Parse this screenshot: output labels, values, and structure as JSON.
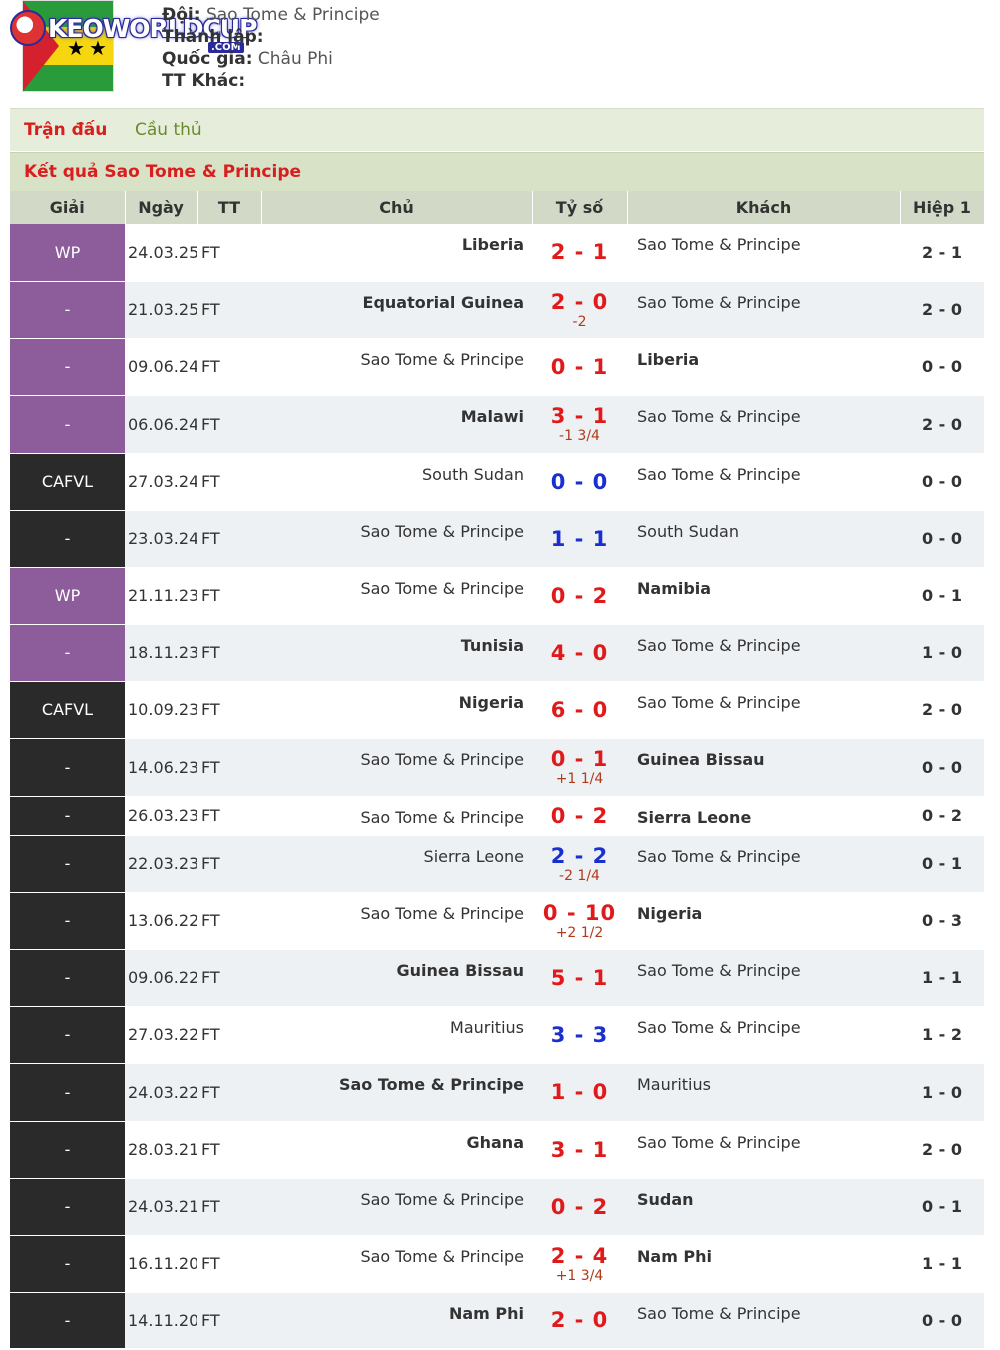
{
  "header": {
    "logo_text": "KEOWORLDCUP",
    "logo_sub": ".COM",
    "team_label": "Đội:",
    "team_value": "Sao Tome & Principe",
    "founded_label": "Thành lập:",
    "country_label": "Quốc gia:",
    "country_value": "Châu Phi",
    "other_label": "TT Khác:"
  },
  "tabs": {
    "matches": "Trận đấu",
    "players": "Cầu thủ"
  },
  "section_title": "Kết quả Sao Tome & Principe",
  "columns": [
    "Giải",
    "Ngày",
    "TT",
    "Chủ",
    "Tỷ số",
    "Khách",
    "Hiệp 1"
  ],
  "rows": [
    {
      "league": "WP",
      "lg": "purple",
      "date": "24.03.25",
      "status": "FT",
      "home": "Liberia",
      "home_bold": true,
      "score": "2 - 1",
      "score_color": "red",
      "hcap": "",
      "away": "Sao Tome & Principe",
      "away_bold": false,
      "ht": "2 - 1",
      "h": 57
    },
    {
      "league": "-",
      "lg": "purple",
      "date": "21.03.25",
      "status": "FT",
      "home": "Equatorial Guinea",
      "home_bold": true,
      "score": "2 - 0",
      "score_color": "red",
      "hcap": "-2",
      "away": "Sao Tome & Principe",
      "away_bold": false,
      "ht": "2 - 0",
      "h": 57
    },
    {
      "league": "-",
      "lg": "purple",
      "date": "09.06.24",
      "status": "FT",
      "home": "Sao Tome & Principe",
      "home_bold": false,
      "score": "0 - 1",
      "score_color": "red",
      "hcap": "",
      "away": "Liberia",
      "away_bold": true,
      "ht": "0 - 0",
      "h": 57
    },
    {
      "league": "-",
      "lg": "purple",
      "date": "06.06.24",
      "status": "FT",
      "home": "Malawi",
      "home_bold": true,
      "score": "3 - 1",
      "score_color": "red",
      "hcap": "-1 3/4",
      "away": "Sao Tome & Principe",
      "away_bold": false,
      "ht": "2 - 0",
      "h": 58
    },
    {
      "league": "CAFVL",
      "lg": "dark",
      "date": "27.03.24",
      "status": "FT",
      "home": "South Sudan",
      "home_bold": false,
      "score": "0 - 0",
      "score_color": "blue",
      "hcap": "",
      "away": "Sao Tome & Principe",
      "away_bold": false,
      "ht": "0 - 0",
      "h": 57
    },
    {
      "league": "-",
      "lg": "dark",
      "date": "23.03.24",
      "status": "FT",
      "home": "Sao Tome & Principe",
      "home_bold": false,
      "score": "1 - 1",
      "score_color": "blue",
      "hcap": "",
      "away": "South Sudan",
      "away_bold": false,
      "ht": "0 - 0",
      "h": 57
    },
    {
      "league": "WP",
      "lg": "purple",
      "date": "21.11.23",
      "status": "FT",
      "home": "Sao Tome & Principe",
      "home_bold": false,
      "score": "0 - 2",
      "score_color": "red",
      "hcap": "",
      "away": "Namibia",
      "away_bold": true,
      "ht": "0 - 1",
      "h": 57
    },
    {
      "league": "-",
      "lg": "purple",
      "date": "18.11.23",
      "status": "FT",
      "home": "Tunisia",
      "home_bold": true,
      "score": "4 - 0",
      "score_color": "red",
      "hcap": "",
      "away": "Sao Tome & Principe",
      "away_bold": false,
      "ht": "1 - 0",
      "h": 57
    },
    {
      "league": "CAFVL",
      "lg": "dark",
      "date": "10.09.23",
      "status": "FT",
      "home": "Nigeria",
      "home_bold": true,
      "score": "6 - 0",
      "score_color": "red",
      "hcap": "",
      "away": "Sao Tome & Principe",
      "away_bold": false,
      "ht": "2 - 0",
      "h": 57
    },
    {
      "league": "-",
      "lg": "dark",
      "date": "14.06.23",
      "status": "FT",
      "home": "Sao Tome & Principe",
      "home_bold": false,
      "score": "0 - 1",
      "score_color": "red",
      "hcap": "+1 1/4",
      "away": "Guinea Bissau",
      "away_bold": true,
      "ht": "0 - 0",
      "h": 58
    },
    {
      "league": "-",
      "lg": "dark",
      "date": "26.03.23",
      "status": "FT",
      "home": "Sao Tome & Principe",
      "home_bold": false,
      "score": "0 - 2",
      "score_color": "red",
      "hcap": "",
      "away": "Sierra Leone",
      "away_bold": true,
      "ht": "0 - 2",
      "h": 39
    },
    {
      "league": "-",
      "lg": "dark",
      "date": "22.03.23",
      "status": "FT",
      "home": "Sierra Leone",
      "home_bold": false,
      "score": "2 - 2",
      "score_color": "blue",
      "hcap": "-2 1/4",
      "away": "Sao Tome & Principe",
      "away_bold": false,
      "ht": "0 - 1",
      "h": 57
    },
    {
      "league": "-",
      "lg": "dark",
      "date": "13.06.22",
      "status": "FT",
      "home": "Sao Tome & Principe",
      "home_bold": false,
      "score": "0 - 10",
      "score_color": "red",
      "hcap": "+2 1/2",
      "away": "Nigeria",
      "away_bold": true,
      "ht": "0 - 3",
      "h": 57
    },
    {
      "league": "-",
      "lg": "dark",
      "date": "09.06.22",
      "status": "FT",
      "home": "Guinea Bissau",
      "home_bold": true,
      "score": "5 - 1",
      "score_color": "red",
      "hcap": "",
      "away": "Sao Tome & Principe",
      "away_bold": false,
      "ht": "1 - 1",
      "h": 57
    },
    {
      "league": "-",
      "lg": "dark",
      "date": "27.03.22",
      "status": "FT",
      "home": "Mauritius",
      "home_bold": false,
      "score": "3 - 3",
      "score_color": "blue",
      "hcap": "",
      "away": "Sao Tome & Principe",
      "away_bold": false,
      "ht": "1 - 2",
      "h": 57
    },
    {
      "league": "-",
      "lg": "dark",
      "date": "24.03.22",
      "status": "FT",
      "home": "Sao Tome & Principe",
      "home_bold": true,
      "score": "1 - 0",
      "score_color": "red",
      "hcap": "",
      "away": "Mauritius",
      "away_bold": false,
      "ht": "1 - 0",
      "h": 58
    },
    {
      "league": "-",
      "lg": "dark",
      "date": "28.03.21",
      "status": "FT",
      "home": "Ghana",
      "home_bold": true,
      "score": "3 - 1",
      "score_color": "red",
      "hcap": "",
      "away": "Sao Tome & Principe",
      "away_bold": false,
      "ht": "2 - 0",
      "h": 57
    },
    {
      "league": "-",
      "lg": "dark",
      "date": "24.03.21",
      "status": "FT",
      "home": "Sao Tome & Principe",
      "home_bold": false,
      "score": "0 - 2",
      "score_color": "red",
      "hcap": "",
      "away": "Sudan",
      "away_bold": true,
      "ht": "0 - 1",
      "h": 57
    },
    {
      "league": "-",
      "lg": "dark",
      "date": "16.11.20",
      "status": "FT",
      "home": "Sao Tome & Principe",
      "home_bold": false,
      "score": "2 - 4",
      "score_color": "red",
      "hcap": "+1 3/4",
      "away": "Nam Phi",
      "away_bold": true,
      "ht": "1 - 1",
      "h": 57
    },
    {
      "league": "-",
      "lg": "dark",
      "date": "14.11.20",
      "status": "FT",
      "home": "Nam Phi",
      "home_bold": true,
      "score": "2 - 0",
      "score_color": "red",
      "hcap": "",
      "away": "Sao Tome & Principe",
      "away_bold": false,
      "ht": "0 - 0",
      "h": 56
    }
  ]
}
